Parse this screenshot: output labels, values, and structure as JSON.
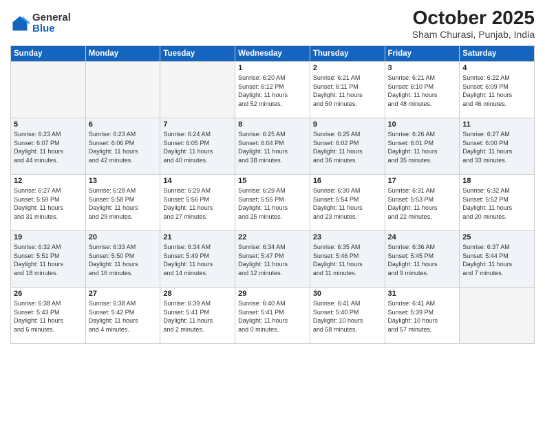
{
  "logo": {
    "general": "General",
    "blue": "Blue"
  },
  "header": {
    "month": "October 2025",
    "location": "Sham Churasi, Punjab, India"
  },
  "weekdays": [
    "Sunday",
    "Monday",
    "Tuesday",
    "Wednesday",
    "Thursday",
    "Friday",
    "Saturday"
  ],
  "weeks": [
    [
      {
        "day": "",
        "info": ""
      },
      {
        "day": "",
        "info": ""
      },
      {
        "day": "",
        "info": ""
      },
      {
        "day": "1",
        "info": "Sunrise: 6:20 AM\nSunset: 6:12 PM\nDaylight: 11 hours\nand 52 minutes."
      },
      {
        "day": "2",
        "info": "Sunrise: 6:21 AM\nSunset: 6:11 PM\nDaylight: 11 hours\nand 50 minutes."
      },
      {
        "day": "3",
        "info": "Sunrise: 6:21 AM\nSunset: 6:10 PM\nDaylight: 11 hours\nand 48 minutes."
      },
      {
        "day": "4",
        "info": "Sunrise: 6:22 AM\nSunset: 6:09 PM\nDaylight: 11 hours\nand 46 minutes."
      }
    ],
    [
      {
        "day": "5",
        "info": "Sunrise: 6:23 AM\nSunset: 6:07 PM\nDaylight: 11 hours\nand 44 minutes."
      },
      {
        "day": "6",
        "info": "Sunrise: 6:23 AM\nSunset: 6:06 PM\nDaylight: 11 hours\nand 42 minutes."
      },
      {
        "day": "7",
        "info": "Sunrise: 6:24 AM\nSunset: 6:05 PM\nDaylight: 11 hours\nand 40 minutes."
      },
      {
        "day": "8",
        "info": "Sunrise: 6:25 AM\nSunset: 6:04 PM\nDaylight: 11 hours\nand 38 minutes."
      },
      {
        "day": "9",
        "info": "Sunrise: 6:25 AM\nSunset: 6:02 PM\nDaylight: 11 hours\nand 36 minutes."
      },
      {
        "day": "10",
        "info": "Sunrise: 6:26 AM\nSunset: 6:01 PM\nDaylight: 11 hours\nand 35 minutes."
      },
      {
        "day": "11",
        "info": "Sunrise: 6:27 AM\nSunset: 6:00 PM\nDaylight: 11 hours\nand 33 minutes."
      }
    ],
    [
      {
        "day": "12",
        "info": "Sunrise: 6:27 AM\nSunset: 5:59 PM\nDaylight: 11 hours\nand 31 minutes."
      },
      {
        "day": "13",
        "info": "Sunrise: 6:28 AM\nSunset: 5:58 PM\nDaylight: 11 hours\nand 29 minutes."
      },
      {
        "day": "14",
        "info": "Sunrise: 6:29 AM\nSunset: 5:56 PM\nDaylight: 11 hours\nand 27 minutes."
      },
      {
        "day": "15",
        "info": "Sunrise: 6:29 AM\nSunset: 5:55 PM\nDaylight: 11 hours\nand 25 minutes."
      },
      {
        "day": "16",
        "info": "Sunrise: 6:30 AM\nSunset: 5:54 PM\nDaylight: 11 hours\nand 23 minutes."
      },
      {
        "day": "17",
        "info": "Sunrise: 6:31 AM\nSunset: 5:53 PM\nDaylight: 11 hours\nand 22 minutes."
      },
      {
        "day": "18",
        "info": "Sunrise: 6:32 AM\nSunset: 5:52 PM\nDaylight: 11 hours\nand 20 minutes."
      }
    ],
    [
      {
        "day": "19",
        "info": "Sunrise: 6:32 AM\nSunset: 5:51 PM\nDaylight: 11 hours\nand 18 minutes."
      },
      {
        "day": "20",
        "info": "Sunrise: 6:33 AM\nSunset: 5:50 PM\nDaylight: 11 hours\nand 16 minutes."
      },
      {
        "day": "21",
        "info": "Sunrise: 6:34 AM\nSunset: 5:49 PM\nDaylight: 11 hours\nand 14 minutes."
      },
      {
        "day": "22",
        "info": "Sunrise: 6:34 AM\nSunset: 5:47 PM\nDaylight: 11 hours\nand 12 minutes."
      },
      {
        "day": "23",
        "info": "Sunrise: 6:35 AM\nSunset: 5:46 PM\nDaylight: 11 hours\nand 11 minutes."
      },
      {
        "day": "24",
        "info": "Sunrise: 6:36 AM\nSunset: 5:45 PM\nDaylight: 11 hours\nand 9 minutes."
      },
      {
        "day": "25",
        "info": "Sunrise: 6:37 AM\nSunset: 5:44 PM\nDaylight: 11 hours\nand 7 minutes."
      }
    ],
    [
      {
        "day": "26",
        "info": "Sunrise: 6:38 AM\nSunset: 5:43 PM\nDaylight: 11 hours\nand 5 minutes."
      },
      {
        "day": "27",
        "info": "Sunrise: 6:38 AM\nSunset: 5:42 PM\nDaylight: 11 hours\nand 4 minutes."
      },
      {
        "day": "28",
        "info": "Sunrise: 6:39 AM\nSunset: 5:41 PM\nDaylight: 11 hours\nand 2 minutes."
      },
      {
        "day": "29",
        "info": "Sunrise: 6:40 AM\nSunset: 5:41 PM\nDaylight: 11 hours\nand 0 minutes."
      },
      {
        "day": "30",
        "info": "Sunrise: 6:41 AM\nSunset: 5:40 PM\nDaylight: 10 hours\nand 58 minutes."
      },
      {
        "day": "31",
        "info": "Sunrise: 6:41 AM\nSunset: 5:39 PM\nDaylight: 10 hours\nand 57 minutes."
      },
      {
        "day": "",
        "info": ""
      }
    ]
  ]
}
